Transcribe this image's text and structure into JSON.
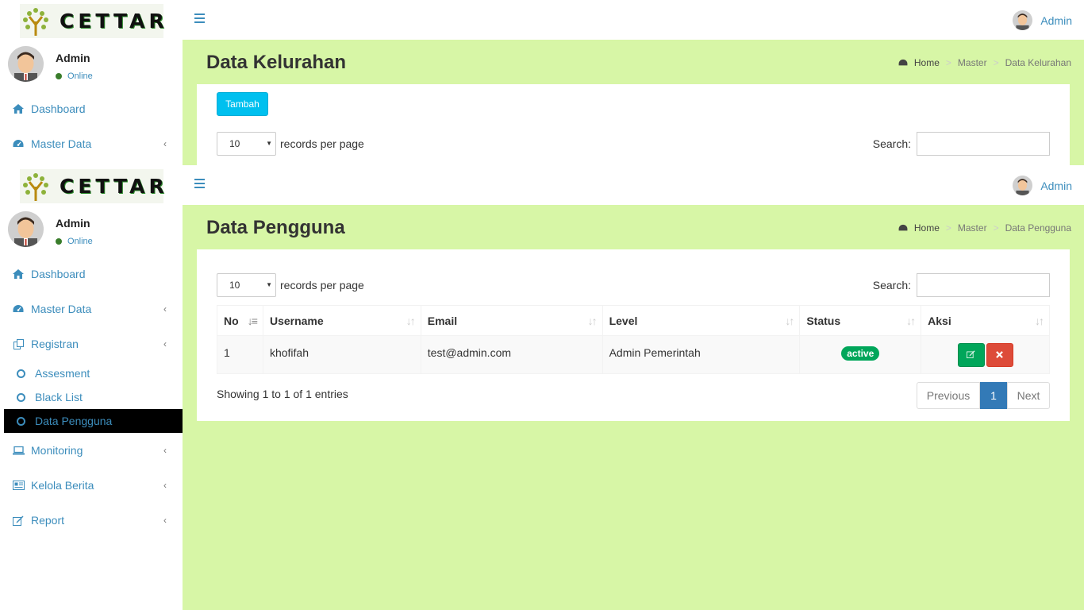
{
  "brand": {
    "name": "CETTAR"
  },
  "user": {
    "name": "Admin",
    "status": "Online"
  },
  "colors": {
    "content_bg": "#d7f6a6",
    "accent": "#3c8dbc",
    "active_nav_bg": "#000000",
    "add_button": "#00c0ef",
    "badge_active": "#00a65a",
    "delete_button": "#dd4b39",
    "pagination_active": "#337ab7"
  },
  "top_frame": {
    "nav": [
      {
        "label": "Dashboard",
        "icon": "home-icon"
      },
      {
        "label": "Master Data",
        "icon": "dashboard-icon"
      }
    ],
    "page_title": "Data Kelurahan",
    "breadcrumb": [
      "Home",
      "Master",
      "Data Kelurahan"
    ],
    "add_button": "Tambah",
    "length_value": "10",
    "length_label": "records per page",
    "search_label": "Search:"
  },
  "bottom_frame": {
    "nav": [
      {
        "label": "Dashboard",
        "icon": "home-icon"
      },
      {
        "label": "Master Data",
        "icon": "dashboard-icon"
      },
      {
        "label": "Registran",
        "icon": "copy-icon"
      },
      {
        "label": "Monitoring",
        "icon": "laptop-icon"
      },
      {
        "label": "Kelola Berita",
        "icon": "newspaper-icon"
      },
      {
        "label": "Report",
        "icon": "edit-icon"
      }
    ],
    "subnav": [
      {
        "label": "Assesment"
      },
      {
        "label": "Black List"
      },
      {
        "label": "Data Pengguna",
        "active": true
      }
    ],
    "page_title": "Data Pengguna",
    "breadcrumb": [
      "Home",
      "Master",
      "Data Pengguna"
    ],
    "length_value": "10",
    "length_label": "records per page",
    "search_label": "Search:",
    "table": {
      "columns": [
        "No",
        "Username",
        "Email",
        "Level",
        "Status",
        "Aksi"
      ],
      "rows": [
        {
          "no": "1",
          "username": "khofifah",
          "email": "test@admin.com",
          "level": "Admin Pemerintah",
          "status": "active"
        }
      ]
    },
    "info": "Showing 1 to 1 of 1 entries",
    "pagination": {
      "previous": "Previous",
      "current": "1",
      "next": "Next"
    }
  }
}
